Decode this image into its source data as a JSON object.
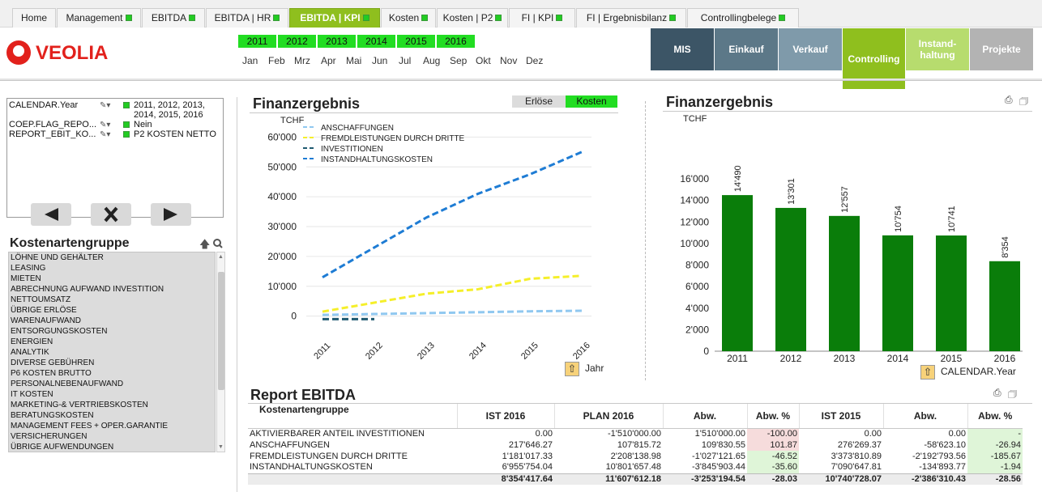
{
  "tabs": [
    {
      "label": "Home",
      "dot": false,
      "active": false
    },
    {
      "label": "Management",
      "dot": true,
      "active": false
    },
    {
      "label": "EBITDA",
      "dot": true,
      "active": false
    },
    {
      "label": "EBITDA | HR",
      "dot": true,
      "active": false
    },
    {
      "label": "EBITDA | KPI",
      "dot": true,
      "active": true
    },
    {
      "label": "Kosten",
      "dot": true,
      "active": false
    },
    {
      "label": "Kosten | P2",
      "dot": true,
      "active": false
    },
    {
      "label": "FI | KPI",
      "dot": true,
      "active": false
    },
    {
      "label": "FI | Ergebnisbilanz",
      "dot": true,
      "active": false
    },
    {
      "label": "Controllingbelege",
      "dot": true,
      "active": false
    }
  ],
  "brand": {
    "name": "VEOLIA",
    "color": "#e2211c",
    "accent": "#8fbf1e"
  },
  "years": [
    "2011",
    "2012",
    "2013",
    "2014",
    "2015",
    "2016"
  ],
  "months": [
    "Jan",
    "Feb",
    "Mrz",
    "Apr",
    "Mai",
    "Jun",
    "Jul",
    "Aug",
    "Sep",
    "Okt",
    "Nov",
    "Dez"
  ],
  "nav_buttons": [
    {
      "label": "MIS",
      "color": "#3c5566"
    },
    {
      "label": "Einkauf",
      "color": "#5c7888"
    },
    {
      "label": "Verkauf",
      "color": "#7f9aaa"
    },
    {
      "label": "Controlling",
      "color": "#8fbf1e"
    },
    {
      "label": "Instand-haltung",
      "color": "#b7dc6e"
    },
    {
      "label": "Projekte",
      "color": "#b3b3b3"
    }
  ],
  "selections": [
    {
      "field": "CALENDAR.Year",
      "value": "2011, 2012, 2013, 2014, 2015, 2016"
    },
    {
      "field": "COEP.FLAG_REPO...",
      "value": "Nein"
    },
    {
      "field": "REPORT_EBIT_KO...",
      "value": "P2 KOSTEN NETTO"
    }
  ],
  "controls": {
    "back_icon": "arrow-left-icon",
    "clear_icon": "close-icon",
    "forward_icon": "arrow-right-icon"
  },
  "kostenartengruppe": {
    "title": "Kostenartengruppe",
    "items": [
      "LÖHNE UND GEHÄLTER",
      "LEASING",
      "MIETEN",
      "ABRECHNUNG AUFWAND INVESTITION",
      "NETTOUMSATZ",
      "ÜBRIGE ERLÖSE",
      "WARENAUFWAND",
      "ENTSORGUNGSKOSTEN",
      "ENERGIEN",
      "ANALYTIK",
      "DIVERSE GEBÜHREN",
      "P6 KOSTEN BRUTTO",
      "PERSONALNEBENAUFWAND",
      "IT KOSTEN",
      "MARKETING-& VERTRIEBSKOSTEN",
      "BERATUNGSKOSTEN",
      "MANAGEMENT FEES + OPER.GARANTIE",
      "VERSICHERUNGEN",
      "ÜBRIGE AUFWENDUNGEN"
    ]
  },
  "line_chart_panel": {
    "title": "Finanzergebnis",
    "toggle_erloese": "Erlöse",
    "toggle_kosten": "Kosten",
    "unit": "TCHF",
    "dimension": "Jahr"
  },
  "bar_chart_panel": {
    "title": "Finanzergebnis",
    "unit": "TCHF",
    "dimension": "CALENDAR.Year"
  },
  "chart_data": [
    {
      "type": "line",
      "x": [
        "2011",
        "2012",
        "2013",
        "2014",
        "2015",
        "2016"
      ],
      "ylim": [
        -2000,
        62000
      ],
      "yticks": [
        0,
        10000,
        20000,
        30000,
        40000,
        50000,
        60000
      ],
      "ytick_labels": [
        "0",
        "10'000",
        "20'000",
        "30'000",
        "40'000",
        "50'000",
        "60'000"
      ],
      "ylabel": "TCHF",
      "xlabel": "Jahr",
      "grid": true,
      "legend": "top-left",
      "series": [
        {
          "name": "ANSCHAFFUNGEN",
          "color": "#90c8f0",
          "values": [
            400,
            700,
            1000,
            1300,
            1600,
            1800
          ]
        },
        {
          "name": "FREMDLEISTUNGEN DURCH DRITTE",
          "color": "#f5ef2a",
          "values": [
            1500,
            4500,
            7500,
            9000,
            12500,
            13500
          ]
        },
        {
          "name": "INVESTITIONEN",
          "color": "#1f5a70",
          "values": [
            -1000,
            -1000,
            null,
            null,
            null,
            null
          ]
        },
        {
          "name": "INSTANDHALTUNGSKOSTEN",
          "color": "#1e7cd4",
          "values": [
            13000,
            23000,
            33000,
            41000,
            47500,
            55000
          ]
        }
      ]
    },
    {
      "type": "bar",
      "categories": [
        "2011",
        "2012",
        "2013",
        "2014",
        "2015",
        "2016"
      ],
      "values": [
        14490,
        13301,
        12557,
        10754,
        10741,
        8354
      ],
      "value_labels": [
        "14'490",
        "13'301",
        "12'557",
        "10'754",
        "10'741",
        "8'354"
      ],
      "ylim": [
        0,
        16000
      ],
      "yticks": [
        0,
        2000,
        4000,
        6000,
        8000,
        10000,
        12000,
        14000,
        16000
      ],
      "ytick_labels": [
        "0",
        "2'000",
        "4'000",
        "6'000",
        "8'000",
        "10'000",
        "12'000",
        "14'000",
        "16'000"
      ],
      "ylabel": "TCHF",
      "xlabel": "CALENDAR.Year",
      "color": "#0a7d0a",
      "grid": false
    }
  ],
  "report": {
    "title": "Report EBITDA",
    "columns": [
      "Kostenartengruppe",
      "IST 2016",
      "PLAN 2016",
      "Abw.",
      "Abw. %",
      "IST 2015",
      "Abw.",
      "Abw. %"
    ],
    "rows": [
      [
        "AKTIVIERBARER ANTEIL INVESTITIONEN",
        "0.00",
        "-1'510'000.00",
        "1'510'000.00",
        "-100.00",
        "0.00",
        "0.00",
        "-"
      ],
      [
        "ANSCHAFFUNGEN",
        "217'646.27",
        "107'815.72",
        "109'830.55",
        "101.87",
        "276'269.37",
        "-58'623.10",
        "-26.94"
      ],
      [
        "FREMDLEISTUNGEN DURCH DRITTE",
        "1'181'017.33",
        "2'208'138.98",
        "-1'027'121.65",
        "-46.52",
        "3'373'810.89",
        "-2'192'793.56",
        "-185.67"
      ],
      [
        "INSTANDHALTUNGSKOSTEN",
        "6'955'754.04",
        "10'801'657.48",
        "-3'845'903.44",
        "-35.60",
        "7'090'647.81",
        "-134'893.77",
        "-1.94"
      ]
    ],
    "total": [
      "",
      "8'354'417.64",
      "11'607'612.18",
      "-3'253'194.54",
      "-28.03",
      "10'740'728.07",
      "-2'386'310.43",
      "-28.56"
    ]
  }
}
